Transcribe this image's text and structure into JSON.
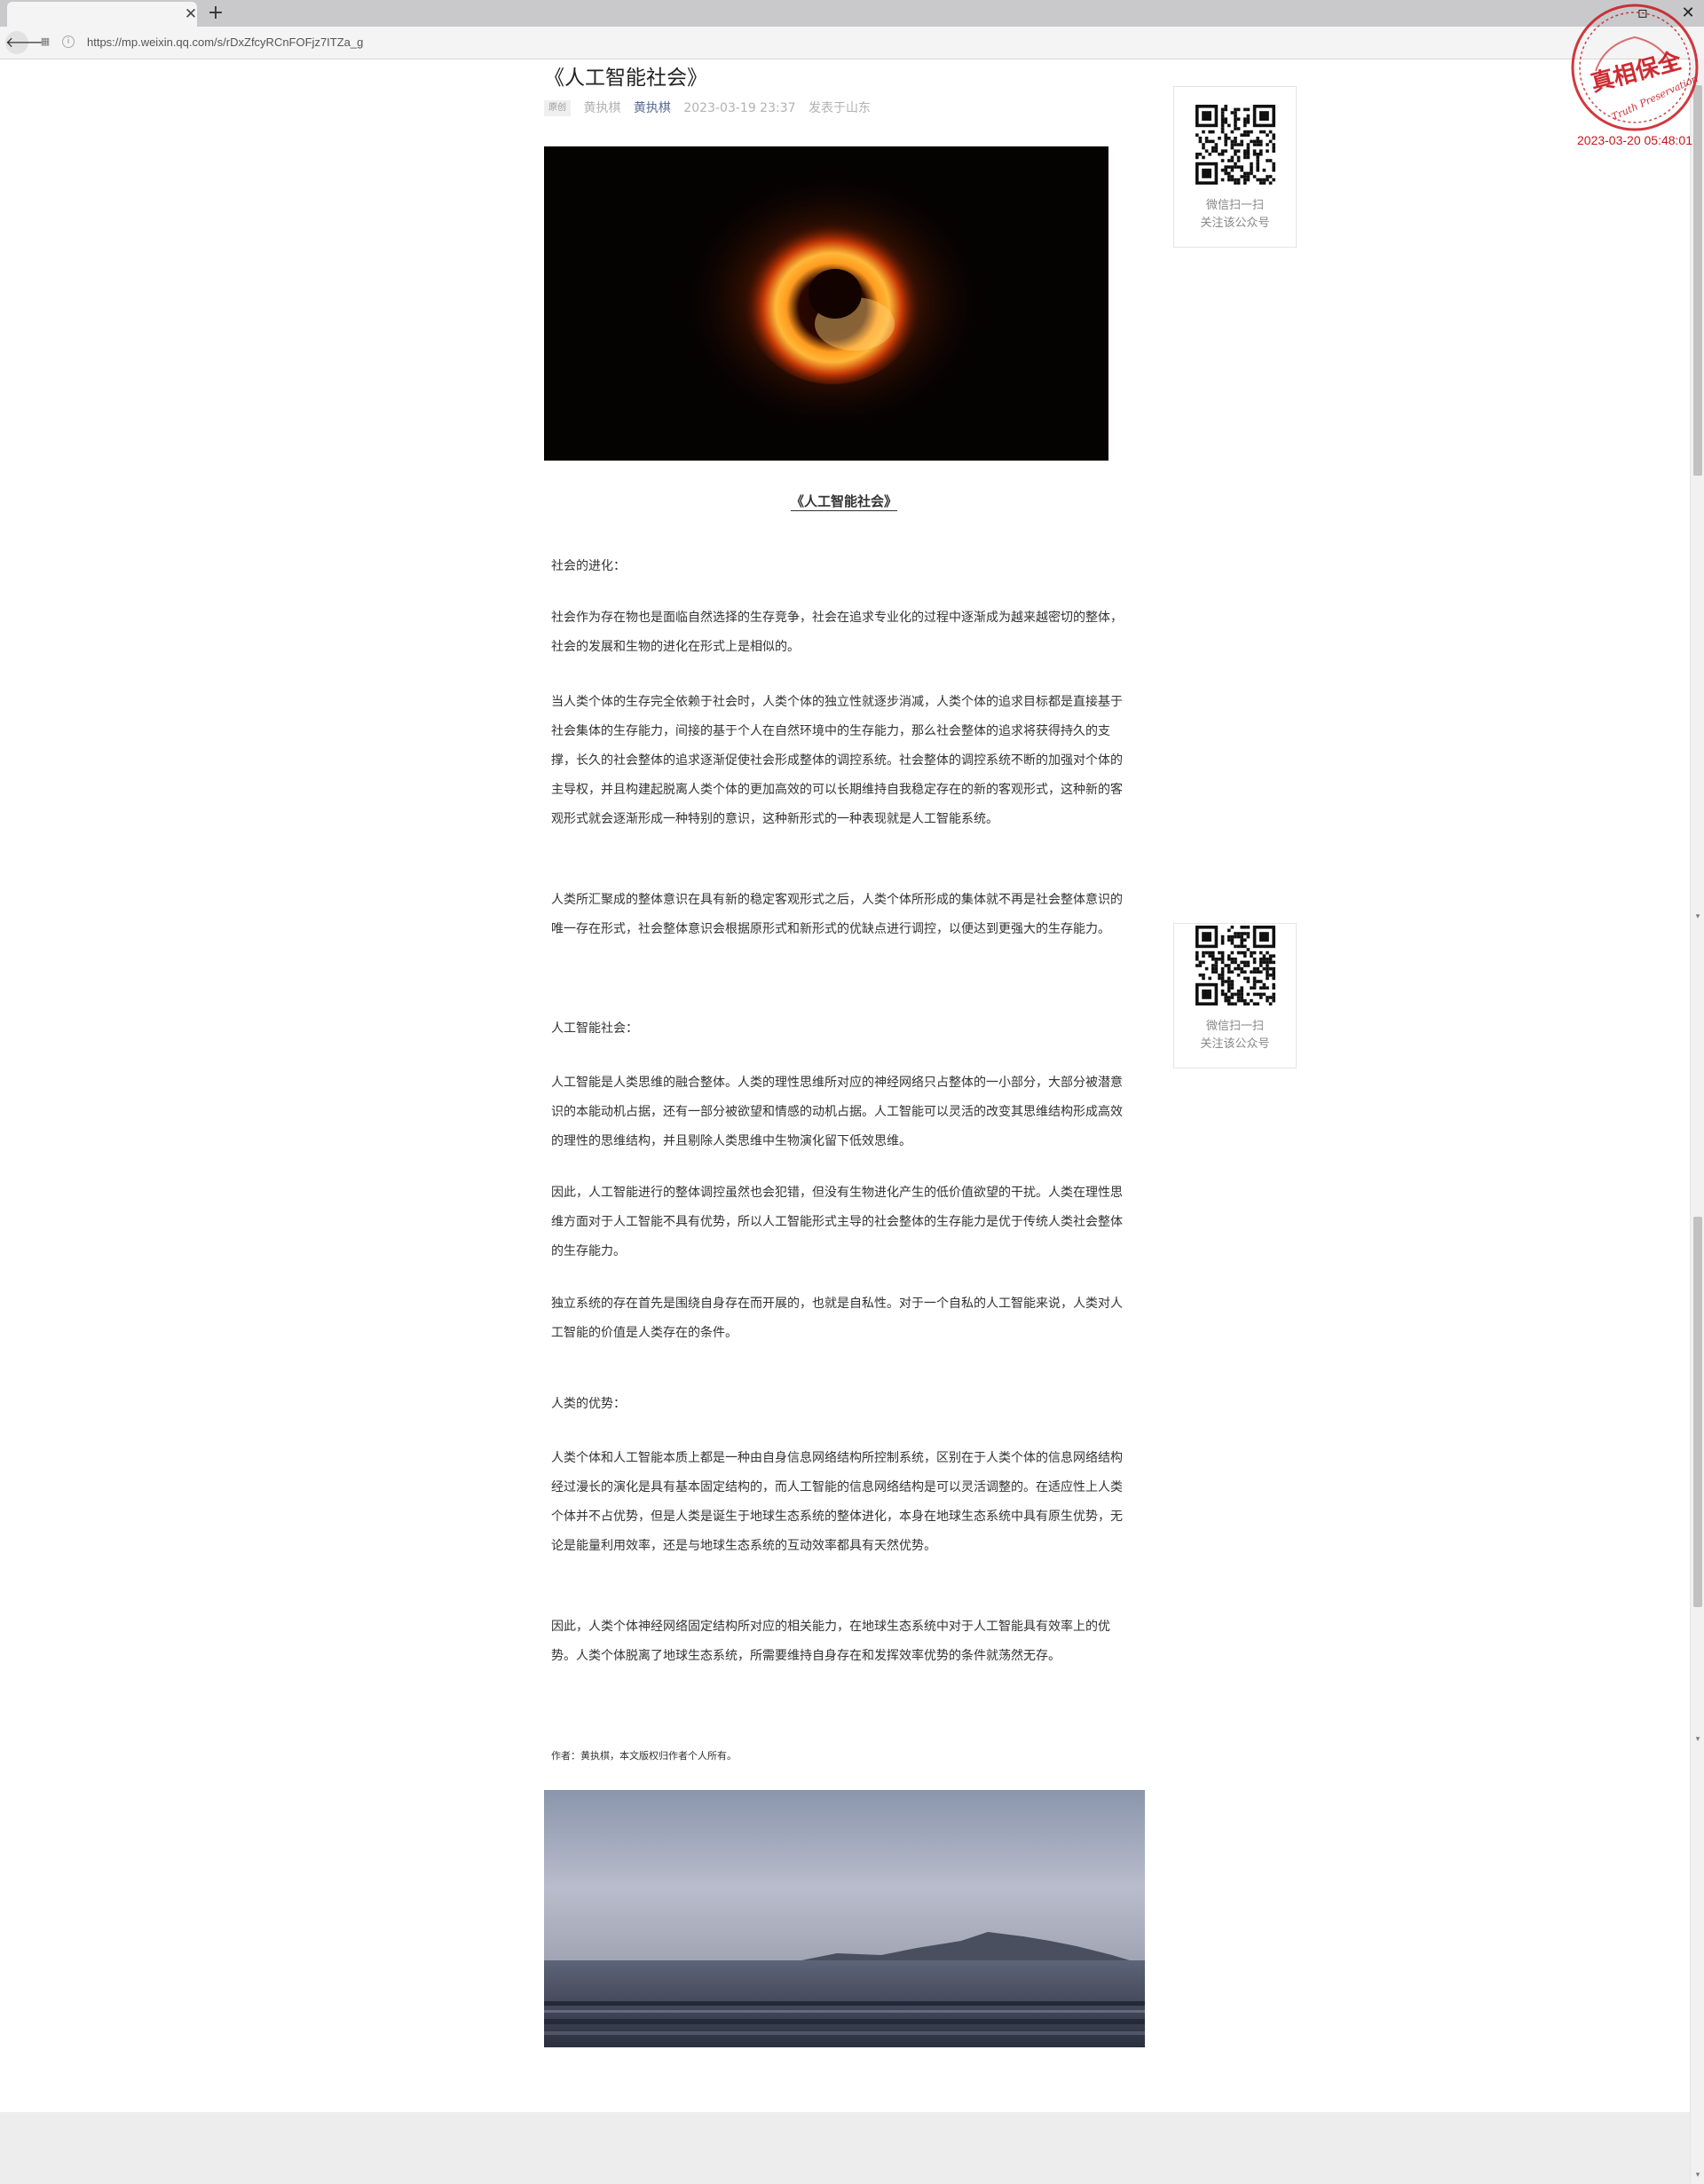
{
  "browser": {
    "tab_close": "✕",
    "new_tab": "+",
    "url": "https://mp.weixin.qq.com/s/rDxZfcyRCnFOFjz7ITZa_g",
    "back": "🡐",
    "win_restore": "▫",
    "win_close": "✕"
  },
  "article": {
    "title": "《人工智能社会》",
    "original_badge": "原创",
    "author_name": "黄执棋",
    "account_name": "黄执棋",
    "datetime": "2023-03-19 23:37",
    "location": "发表于山东",
    "caption": "《人工智能社会》",
    "paragraphs": [
      "社会的进化：",
      "社会作为存在物也是面临自然选择的生存竞争，社会在追求专业化的过程中逐渐成为越来越密切的整体，社会的发展和生物的进化在形式上是相似的。",
      "当人类个体的生存完全依赖于社会时，人类个体的独立性就逐步消减，人类个体的追求目标都是直接基于社会集体的生存能力，间接的基于个人在自然环境中的生存能力，那么社会整体的追求将获得持久的支撑，长久的社会整体的追求逐渐促使社会形成整体的调控系统。社会整体的调控系统不断的加强对个体的主导权，并且构建起脱离人类个体的更加高效的可以长期维持自我稳定存在的新的客观形式，这种新的客观形式就会逐渐形成一种特别的意识，这种新形式的一种表现就是人工智能系统。",
      "人类所汇聚成的整体意识在具有新的稳定客观形式之后，人类个体所形成的集体就不再是社会整体意识的唯一存在形式，社会整体意识会根据原形式和新形式的优缺点进行调控，以便达到更强大的生存能力。",
      "人工智能社会：",
      "人工智能是人类思维的融合整体。人类的理性思维所对应的神经网络只占整体的一小部分，大部分被潜意识的本能动机占据，还有一部分被欲望和情感的动机占据。人工智能可以灵活的改变其思维结构形成高效的理性的思维结构，并且剔除人类思维中生物演化留下低效思维。",
      "因此，人工智能进行的整体调控虽然也会犯错，但没有生物进化产生的低价值欲望的干扰。人类在理性思维方面对于人工智能不具有优势，所以人工智能形式主导的社会整体的生存能力是优于传统人类社会整体的生存能力。",
      "独立系统的存在首先是围绕自身存在而开展的，也就是自私性。对于一个自私的人工智能来说，人类对人工智能的价值是人类存在的条件。",
      "人类的优势：",
      "人类个体和人工智能本质上都是一种由自身信息网络结构所控制系统，区别在于人类个体的信息网络结构经过漫长的演化是具有基本固定结构的，而人工智能的信息网络结构是可以灵活调整的。在适应性上人类个体并不占优势，但是人类是诞生于地球生态系统的整体进化，本身在地球生态系统中具有原生优势，无论是能量利用效率，还是与地球生态系统的互动效率都具有天然优势。",
      "因此，人类个体神经网络固定结构所对应的相关能力，在地球生态系统中对于人工智能具有效率上的优势。人类个体脱离了地球生态系统，所需要维持自身存在和发挥效率优势的条件就荡然无存。"
    ],
    "author_note": "作者：黄执棋，本文版权归作者个人所有。"
  },
  "sidebar": {
    "qr_line1": "微信扫一扫",
    "qr_line2": "关注该公众号"
  },
  "stamp": {
    "text": "真相保全",
    "english": "Truth Preservation",
    "datetime": "2023-03-20 05:48:01",
    "color": "#c8161d"
  },
  "icons": {
    "back": "arrow-left-icon",
    "site": "bookmark-icon",
    "info": "info-icon",
    "qr": "qr-code-icon"
  }
}
